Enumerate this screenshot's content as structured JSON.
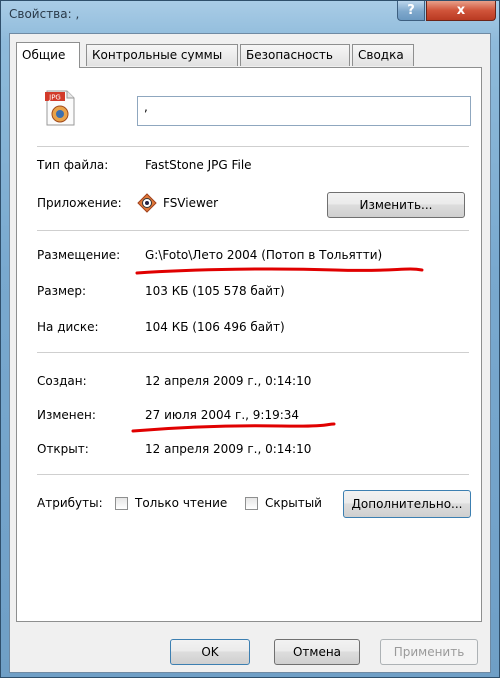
{
  "window": {
    "title": "Свойства: ,",
    "help_label": "?",
    "close_label": "x"
  },
  "tabs": [
    "Общие",
    "Контрольные суммы",
    "Безопасность",
    "Сводка"
  ],
  "file": {
    "icon_text": "JPG",
    "name_value": ",",
    "type_label": "Тип файла:",
    "type_value": "FastStone JPG File",
    "app_label": "Приложение:",
    "app_value": "FSViewer",
    "change_button": "Изменить...",
    "location_label": "Размещение:",
    "location_value": "G:\\Foto\\Лето 2004 (Потоп в Тольятти)",
    "size_label": "Размер:",
    "size_value": "103 КБ (105 578 байт)",
    "disk_label": "На диске:",
    "disk_value": "104 КБ (106 496 байт)",
    "created_label": "Создан:",
    "created_value": "12 апреля 2009 г., 0:14:10",
    "modified_label": "Изменен:",
    "modified_value": "27 июля 2004 г., 9:19:34",
    "opened_label": "Открыт:",
    "opened_value": "12 апреля 2009 г., 0:14:10",
    "attributes_label": "Атрибуты:",
    "readonly_label": "Только чтение",
    "hidden_label": "Скрытый",
    "advanced_button": "Дополнительно..."
  },
  "footer": {
    "ok": "OK",
    "cancel": "Отмена",
    "apply": "Применить"
  },
  "colors": {
    "annotation_red": "#e00000"
  }
}
